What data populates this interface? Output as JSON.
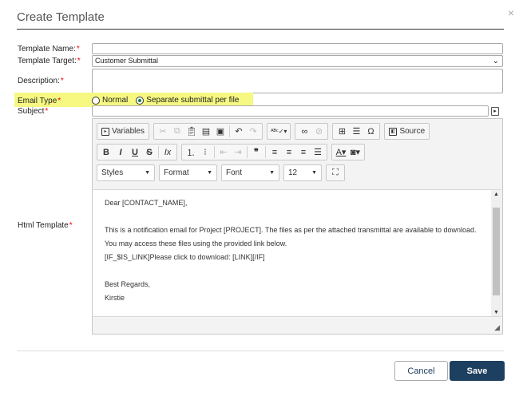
{
  "dialog": {
    "title": "Create Template",
    "close_glyph": "×"
  },
  "form": {
    "template_name_label": "Template Name:",
    "template_target_label": "Template Target:",
    "template_target_value": "Customer Submittal",
    "description_label": "Description:",
    "email_type_label": "Email Type",
    "email_type_options": [
      "Normal",
      "Separate submittal per file"
    ],
    "email_type_selected": "Separate submittal per file",
    "subject_label": "Subject",
    "html_template_label": "Html Template",
    "required_mark": "*"
  },
  "editor": {
    "toolbar": {
      "variables": "Variables",
      "source": "Source",
      "styles": "Styles",
      "format": "Format",
      "font": "Font",
      "size": "12"
    },
    "content": [
      "Dear [CONTACT_NAME],",
      "",
      "This is a notification email for Project [PROJECT]. The files as per the attached transmittal are available to download.",
      "You may access these files using the provided link below.",
      "[IF_$IS_LINK]Please click to download: [LINK][/IF]",
      "",
      "Best Regards,",
      "Kirstie"
    ]
  },
  "footer": {
    "cancel_label": "Cancel",
    "save_label": "Save"
  },
  "colors": {
    "highlight": "#f6f882",
    "primary_button": "#1d3f60",
    "required": "#e00000",
    "radio_selected": "#1c7a3e"
  }
}
